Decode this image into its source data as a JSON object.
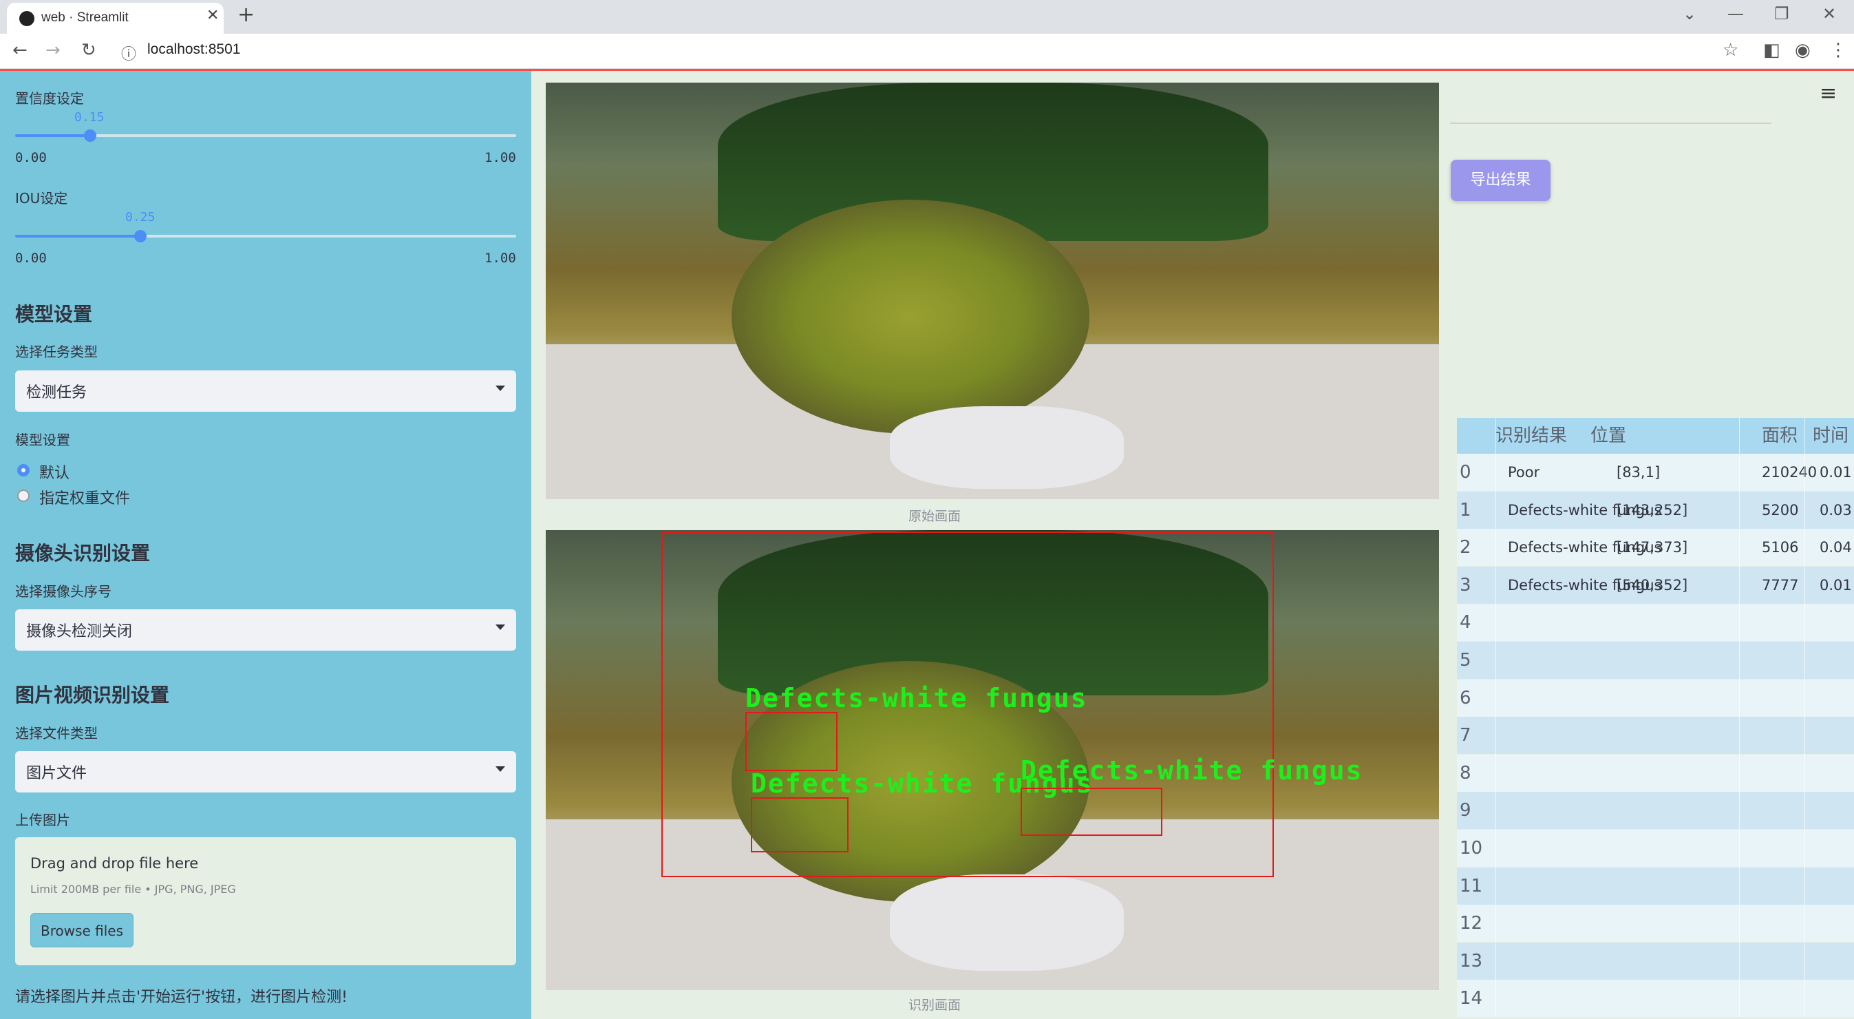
{
  "browser": {
    "tab_title": "web · Streamlit",
    "url": "localhost:8501"
  },
  "sidebar": {
    "conf_label": "置信度设定",
    "conf_value": "0.15",
    "conf_value_num": 0.15,
    "conf_min": "0.00",
    "conf_max": "1.00",
    "iou_label": "IOU设定",
    "iou_value": "0.25",
    "iou_value_num": 0.25,
    "iou_min": "0.00",
    "iou_max": "1.00",
    "model_heading": "模型设置",
    "task_label": "选择任务类型",
    "task_value": "检测任务",
    "model_label": "模型设置",
    "radio_default": "默认",
    "radio_custom": "指定权重文件",
    "camera_heading": "摄像头识别设置",
    "camera_label": "选择摄像头序号",
    "camera_value": "摄像头检测关闭",
    "media_heading": "图片视频识别设置",
    "filetype_label": "选择文件类型",
    "filetype_value": "图片文件",
    "upload_label": "上传图片",
    "drop_title": "Drag and drop file here",
    "drop_limit": "Limit 200MB per file • JPG, PNG, JPEG",
    "browse_label": "Browse files",
    "hint": "请选择图片并点击'开始运行'按钮，进行图片检测!"
  },
  "main": {
    "orig_caption": "原始画面",
    "result_caption": "识别画面",
    "detections": [
      {
        "label": "Defects-white fungus"
      },
      {
        "label": "Defects-white fungus"
      },
      {
        "label": "Defects-white fungus"
      }
    ]
  },
  "right": {
    "export_label": "导出结果",
    "headers": [
      "识别结果",
      "位置",
      "面积",
      "时间"
    ],
    "rows": [
      {
        "idx": "0",
        "result": "Poor",
        "pos": "[83,1]",
        "area": "210240",
        "time": "0.01"
      },
      {
        "idx": "1",
        "result": "Defects-white fungus",
        "pos": "[143,252]",
        "area": "5200",
        "time": "0.03"
      },
      {
        "idx": "2",
        "result": "Defects-white fungus",
        "pos": "[147,373]",
        "area": "5106",
        "time": "0.04"
      },
      {
        "idx": "3",
        "result": "Defects-white fungus",
        "pos": "[540,352]",
        "area": "7777",
        "time": "0.01"
      },
      {
        "idx": "4"
      },
      {
        "idx": "5"
      },
      {
        "idx": "6"
      },
      {
        "idx": "7"
      },
      {
        "idx": "8"
      },
      {
        "idx": "9"
      },
      {
        "idx": "10"
      },
      {
        "idx": "11"
      },
      {
        "idx": "12"
      },
      {
        "idx": "13"
      },
      {
        "idx": "14"
      }
    ]
  },
  "colors": {
    "sidebar_bg": "#78c6dc",
    "accent": "#4c8df6",
    "export_button": "#9a97ec",
    "box_red": "#e21a1a",
    "label_green": "#1cf01c"
  }
}
